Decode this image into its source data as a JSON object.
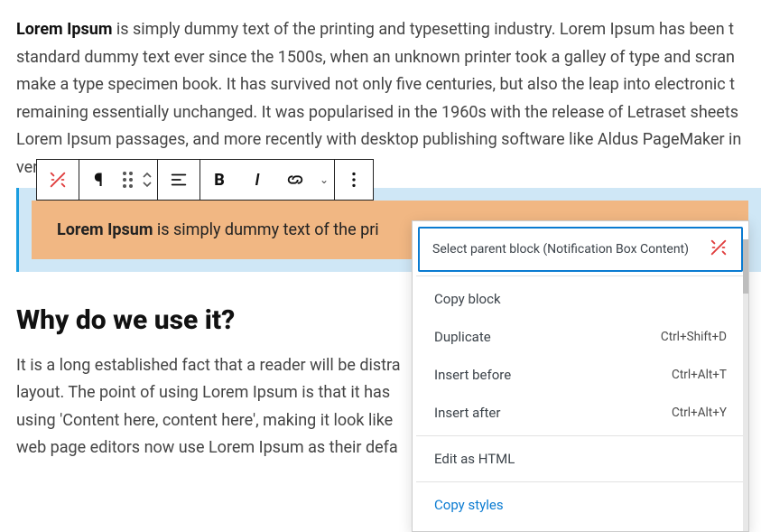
{
  "para1": {
    "lead": "Lorem Ipsum",
    "rest1": " is simply dummy text of the printing and typesetting industry. Lorem Ipsum has been t",
    "line2": "standard dummy text ever since the 1500s, when an unknown printer took a galley of type and scran",
    "line3": "make a type specimen book. It has survived not only five centuries, but also the leap into electronic t",
    "line4": "remaining essentially unchanged. It was popularised in the 1960s with the release of Letraset sheets ",
    "line5": "Lorem Ipsum passages, and more recently with desktop publishing software like Aldus PageMaker in",
    "line6": "versions of Lorem Ipsum."
  },
  "notif": {
    "lead": "Lorem Ipsum",
    "rest": " is simply dummy text of the pri"
  },
  "h2": "Why do we use it?",
  "para2": {
    "line1": "It is a long established fact that a reader will be distra",
    "line2": "layout. The point of using Lorem Ipsum is that it has ",
    "line3": "using 'Content here, content here', making it look like",
    "line4": "web page editors now use Lorem Ipsum as their defa"
  },
  "menu": {
    "parent": "Select parent block (Notification Box Content)",
    "copy_block": "Copy block",
    "duplicate": "Duplicate",
    "dup_kbd": "Ctrl+Shift+D",
    "insert_before": "Insert before",
    "ib_kbd": "Ctrl+Alt+T",
    "insert_after": "Insert after",
    "ia_kbd": "Ctrl+Alt+Y",
    "edit_html": "Edit as HTML",
    "copy_styles": "Copy styles"
  }
}
